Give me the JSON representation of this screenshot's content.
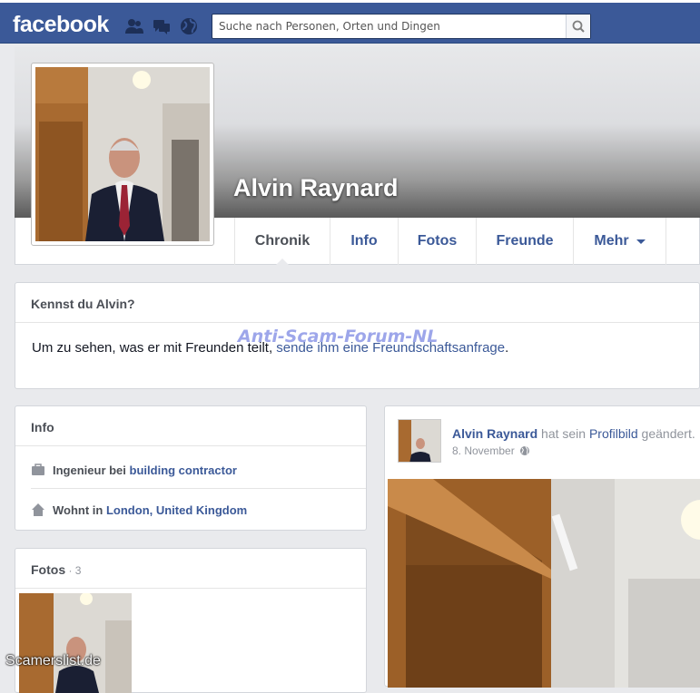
{
  "header": {
    "logo": "facebook",
    "search_placeholder": "Suche nach Personen, Orten und Dingen"
  },
  "profile": {
    "name": "Alvin Raynard"
  },
  "tabs": [
    {
      "label": "Chronik"
    },
    {
      "label": "Info"
    },
    {
      "label": "Fotos"
    },
    {
      "label": "Freunde"
    },
    {
      "label": "Mehr"
    }
  ],
  "know_card": {
    "title": "Kennst du Alvin?",
    "text_before": "Um zu sehen, was er mit Freunden teilt, ",
    "link": "sende ihm eine Freundschaftsanfrage",
    "text_after": "."
  },
  "info_card": {
    "title": "Info",
    "work_prefix": "Ingenieur bei ",
    "work_link": "building contractor",
    "home_prefix": "Wohnt in ",
    "home_link": "London, United Kingdom"
  },
  "photos_card": {
    "title": "Fotos",
    "count": " · 3"
  },
  "post": {
    "author": "Alvin Raynard",
    "action_before": " hat sein ",
    "action_link": "Profilbild",
    "action_after": " geändert.",
    "date": "8. November"
  },
  "watermarks": {
    "forum": "Anti-Scam-Forum-NL",
    "site": "Scamerslist.de"
  },
  "colors": {
    "brand": "#3b5998",
    "background": "#e9eaed"
  },
  "icons": [
    "friends-icon",
    "messages-icon",
    "globe-icon",
    "search-icon",
    "briefcase-icon",
    "house-icon",
    "public-globe-icon",
    "dropdown-caret-icon"
  ]
}
